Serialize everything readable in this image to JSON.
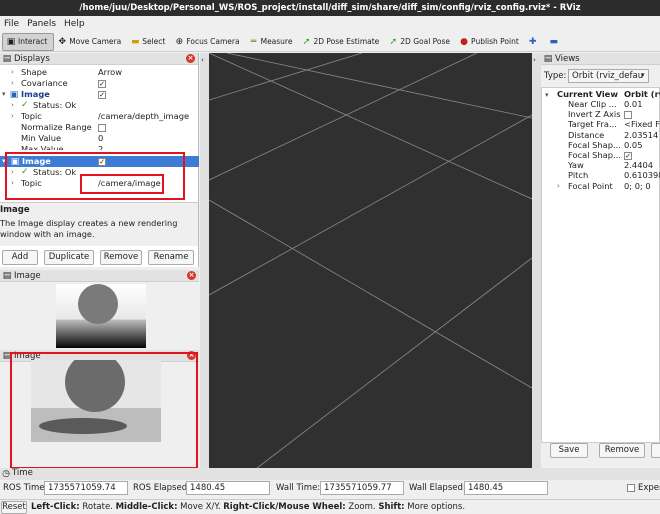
{
  "window": {
    "title": "/home/juu/Desktop/Personal_WS/ROS_project/install/diff_sim/share/diff_sim/config/rviz_config.rviz* - RViz"
  },
  "menu": {
    "file": "File",
    "panels": "Panels",
    "help": "Help"
  },
  "toolbar": {
    "interact": "Interact",
    "move_camera": "Move Camera",
    "select": "Select",
    "focus_camera": "Focus Camera",
    "measure": "Measure",
    "pose_estimate": "2D Pose Estimate",
    "goal_pose": "2D Goal Pose",
    "publish_point": "Publish Point"
  },
  "displays": {
    "title": "Displays",
    "rows": {
      "shape_label": "Shape",
      "shape_value": "Arrow",
      "covariance_label": "Covariance",
      "image1_label": "Image",
      "status1_label": "Status: Ok",
      "topic1_label": "Topic",
      "topic1_value": "/camera/depth_image",
      "normalize_label": "Normalize Range",
      "min_label": "Min Value",
      "min_value": "0",
      "max_label": "Max Value",
      "max_value": "2",
      "image2_label": "Image",
      "status2_label": "Status: Ok",
      "topic2_label": "Topic",
      "topic2_value": "/camera/image"
    },
    "description_title": "Image",
    "description_text": "The Image display creates a new rendering window with an image.",
    "buttons": {
      "add": "Add",
      "duplicate": "Duplicate",
      "remove": "Remove",
      "rename": "Rename"
    }
  },
  "image_panel1": {
    "title": "Image"
  },
  "image_panel2": {
    "title": "Image"
  },
  "views": {
    "title": "Views",
    "type_label": "Type:",
    "type_value": "Orbit (rviz_defau",
    "header_name": "Current View",
    "header_value": "Orbit (rv",
    "props": [
      {
        "label": "Near Clip ...",
        "value": "0.01"
      },
      {
        "label": "Invert Z Axis",
        "value": ""
      },
      {
        "label": "Target Fra...",
        "value": "<Fixed Fr"
      },
      {
        "label": "Distance",
        "value": "2.03514"
      },
      {
        "label": "Focal Shap...",
        "value": "0.05"
      },
      {
        "label": "Focal Shap...",
        "value": ""
      },
      {
        "label": "Yaw",
        "value": "2.4404"
      },
      {
        "label": "Pitch",
        "value": "0.610398"
      },
      {
        "label": "Focal Point",
        "value": "0; 0; 0"
      }
    ],
    "save": "Save",
    "remove": "Remove"
  },
  "time": {
    "title": "Time",
    "ros_time_label": "ROS Time:",
    "ros_time": "1735571059.74",
    "ros_elapsed_label": "ROS Elapsed:",
    "ros_elapsed": "1480.45",
    "wall_time_label": "Wall Time:",
    "wall_time": "1735571059.77",
    "wall_elapsed_label": "Wall Elapsed:",
    "wall_elapsed": "1480.45",
    "experimental": "Exper"
  },
  "status": {
    "reset": "Reset",
    "hint_left_bold": "Left-Click:",
    "hint_left": " Rotate. ",
    "hint_middle_bold": "Middle-Click:",
    "hint_middle": " Move X/Y. ",
    "hint_right_bold": "Right-Click/Mouse Wheel:",
    "hint_right": " Zoom. ",
    "hint_shift_bold": "Shift:",
    "hint_shift": " More options."
  }
}
